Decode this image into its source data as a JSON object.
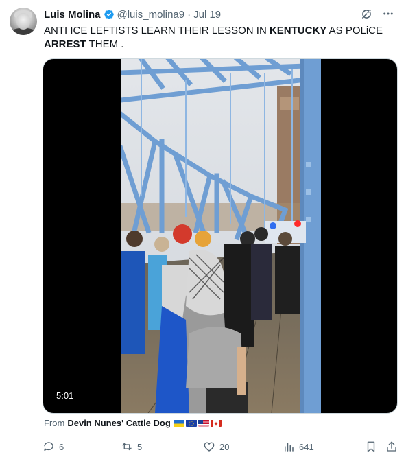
{
  "author": {
    "name": "Luis Molina",
    "handle": "@luis_molina9",
    "separator": "·",
    "date": "Jul 19"
  },
  "tweet": {
    "text_parts": [
      {
        "text": "ANTI ICE LEFTISTS LEARN THEIR LESSON IN ",
        "bold": false
      },
      {
        "text": "KENTUCKY",
        "bold": true
      },
      {
        "text": " AS POLiCE ",
        "bold": false
      },
      {
        "text": "ARREST",
        "bold": true
      },
      {
        "text": " THEM .",
        "bold": false
      }
    ]
  },
  "media": {
    "duration": "5:01"
  },
  "attribution": {
    "prefix": "From",
    "source": "Devin Nunes' Cattle Dog",
    "flags": [
      "ukraine-flag",
      "eu-flag",
      "us-flag",
      "canada-flag"
    ]
  },
  "actions": {
    "replies": "6",
    "reposts": "5",
    "likes": "20",
    "views": "641"
  },
  "colors": {
    "verified": "#1d9bf0",
    "secondary_text": "#536471",
    "primary_text": "#0f1419",
    "bridge_blue": "#6f9ed3"
  }
}
